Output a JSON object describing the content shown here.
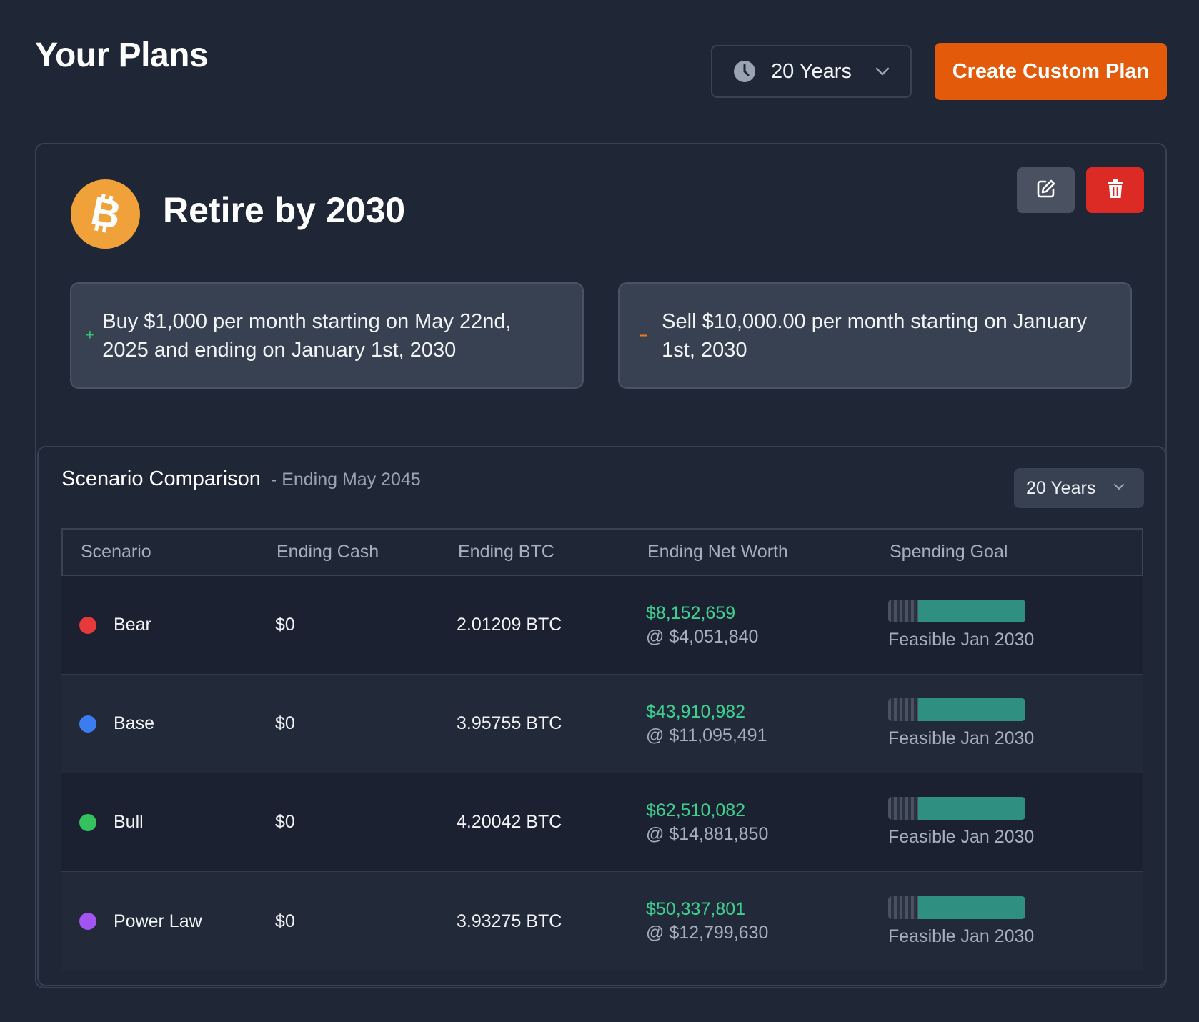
{
  "header": {
    "title": "Your Plans",
    "years_select": "20 Years",
    "create_button": "Create Custom Plan"
  },
  "plan": {
    "title": "Retire by 2030",
    "icon": "bitcoin-icon",
    "buy": {
      "sign": "+",
      "text": "Buy $1,000 per month starting on May 22nd, 2025 and ending on January 1st, 2030"
    },
    "sell": {
      "sign": "–",
      "text": "Sell $10,000.00 per month starting on January 1st, 2030"
    }
  },
  "scenario_comparison": {
    "title": "Scenario Comparison",
    "subtitle": "- Ending May 2045",
    "years_select": "20 Years",
    "columns": [
      "Scenario",
      "Ending Cash",
      "Ending BTC",
      "Ending Net Worth",
      "Spending Goal"
    ],
    "rows": [
      {
        "name": "Bear",
        "color": "#e5393a",
        "cash": "$0",
        "btc": "2.01209 BTC",
        "net_worth": "$8,152,659",
        "at_price": "@ $4,051,840",
        "goal_progress": 0.78,
        "goal_text": "Feasible Jan 2030"
      },
      {
        "name": "Base",
        "color": "#3b7cf0",
        "cash": "$0",
        "btc": "3.95755 BTC",
        "net_worth": "$43,910,982",
        "at_price": "@ $11,095,491",
        "goal_progress": 0.78,
        "goal_text": "Feasible Jan 2030"
      },
      {
        "name": "Bull",
        "color": "#35c15e",
        "cash": "$0",
        "btc": "4.20042 BTC",
        "net_worth": "$62,510,082",
        "at_price": "@ $14,881,850",
        "goal_progress": 0.78,
        "goal_text": "Feasible Jan 2030"
      },
      {
        "name": "Power Law",
        "color": "#a255f0",
        "cash": "$0",
        "btc": "3.93275 BTC",
        "net_worth": "$50,337,801",
        "at_price": "@ $12,799,630",
        "goal_progress": 0.78,
        "goal_text": "Feasible Jan 2030"
      }
    ]
  },
  "colors": {
    "background": "#1f2635",
    "accent_orange": "#e35a0b",
    "delete_red": "#dc2a25",
    "net_worth_green": "#3fcf8e",
    "goal_teal": "#2f8f80"
  }
}
